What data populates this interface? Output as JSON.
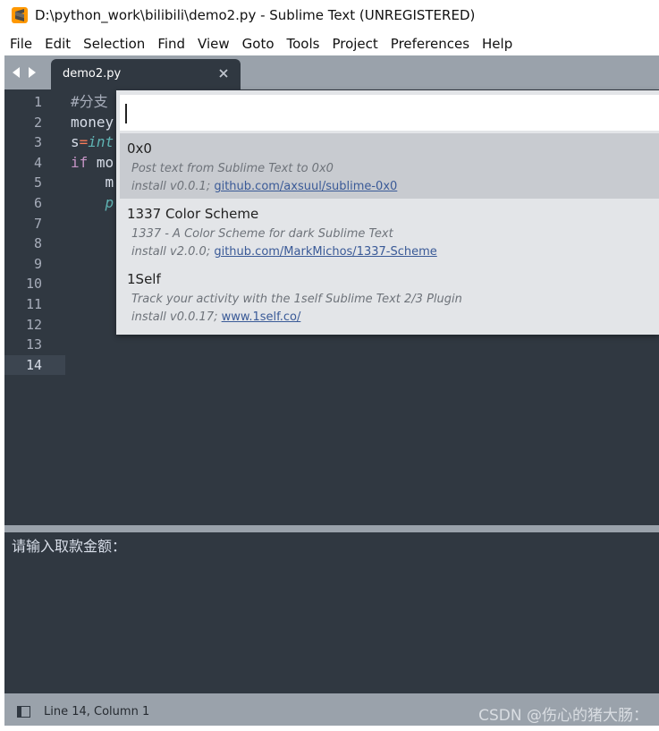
{
  "window": {
    "title": "D:\\python_work\\bilibili\\demo2.py - Sublime Text (UNREGISTERED)",
    "logo_icon": "sublime-logo-icon"
  },
  "menu": [
    "File",
    "Edit",
    "Selection",
    "Find",
    "View",
    "Goto",
    "Tools",
    "Project",
    "Preferences",
    "Help"
  ],
  "tabs": {
    "active_label": "demo2.py"
  },
  "editor": {
    "line_numbers": [
      "1",
      "2",
      "3",
      "4",
      "5",
      "6",
      "7",
      "8",
      "9",
      "10",
      "11",
      "12",
      "13",
      "14"
    ],
    "active_line": "14",
    "code": {
      "l1": "#分支",
      "l2": "money",
      "l3_prefix": "s",
      "l3_op": "=",
      "l3_fn": "int",
      "l4_kw": "if",
      "l4_rest": " mo",
      "l5": "    m",
      "l6": "    p"
    }
  },
  "command_palette": {
    "input_value": "",
    "packages": [
      {
        "name": "0x0",
        "description": "Post text from Sublime Text to 0x0",
        "install_prefix": "install v0.0.1;",
        "link": "github.com/axsuul/sublime-0x0",
        "selected": true
      },
      {
        "name": "1337 Color Scheme",
        "description": "1337 - A Color Scheme for dark Sublime Text",
        "install_prefix": "install v2.0.0;",
        "link": "github.com/MarkMichos/1337-Scheme",
        "selected": false
      },
      {
        "name": "1Self",
        "description": "Track your activity with the 1self Sublime Text 2/3 Plugin",
        "install_prefix": "install v0.0.17;",
        "link": "www.1self.co/",
        "selected": false
      }
    ]
  },
  "console": {
    "output": "请输入取款金额："
  },
  "status": {
    "position": "Line 14, Column 1",
    "watermark": "CSDN @伤心的猪大肠："
  },
  "colors": {
    "editor_bg": "#303841",
    "chrome_gray": "#9aa2ab",
    "palette_bg": "#e3e5e8",
    "selected_row": "#c8cbd0",
    "keyword": "#c594c5",
    "function": "#5fb3b3",
    "operator": "#f97b58"
  }
}
